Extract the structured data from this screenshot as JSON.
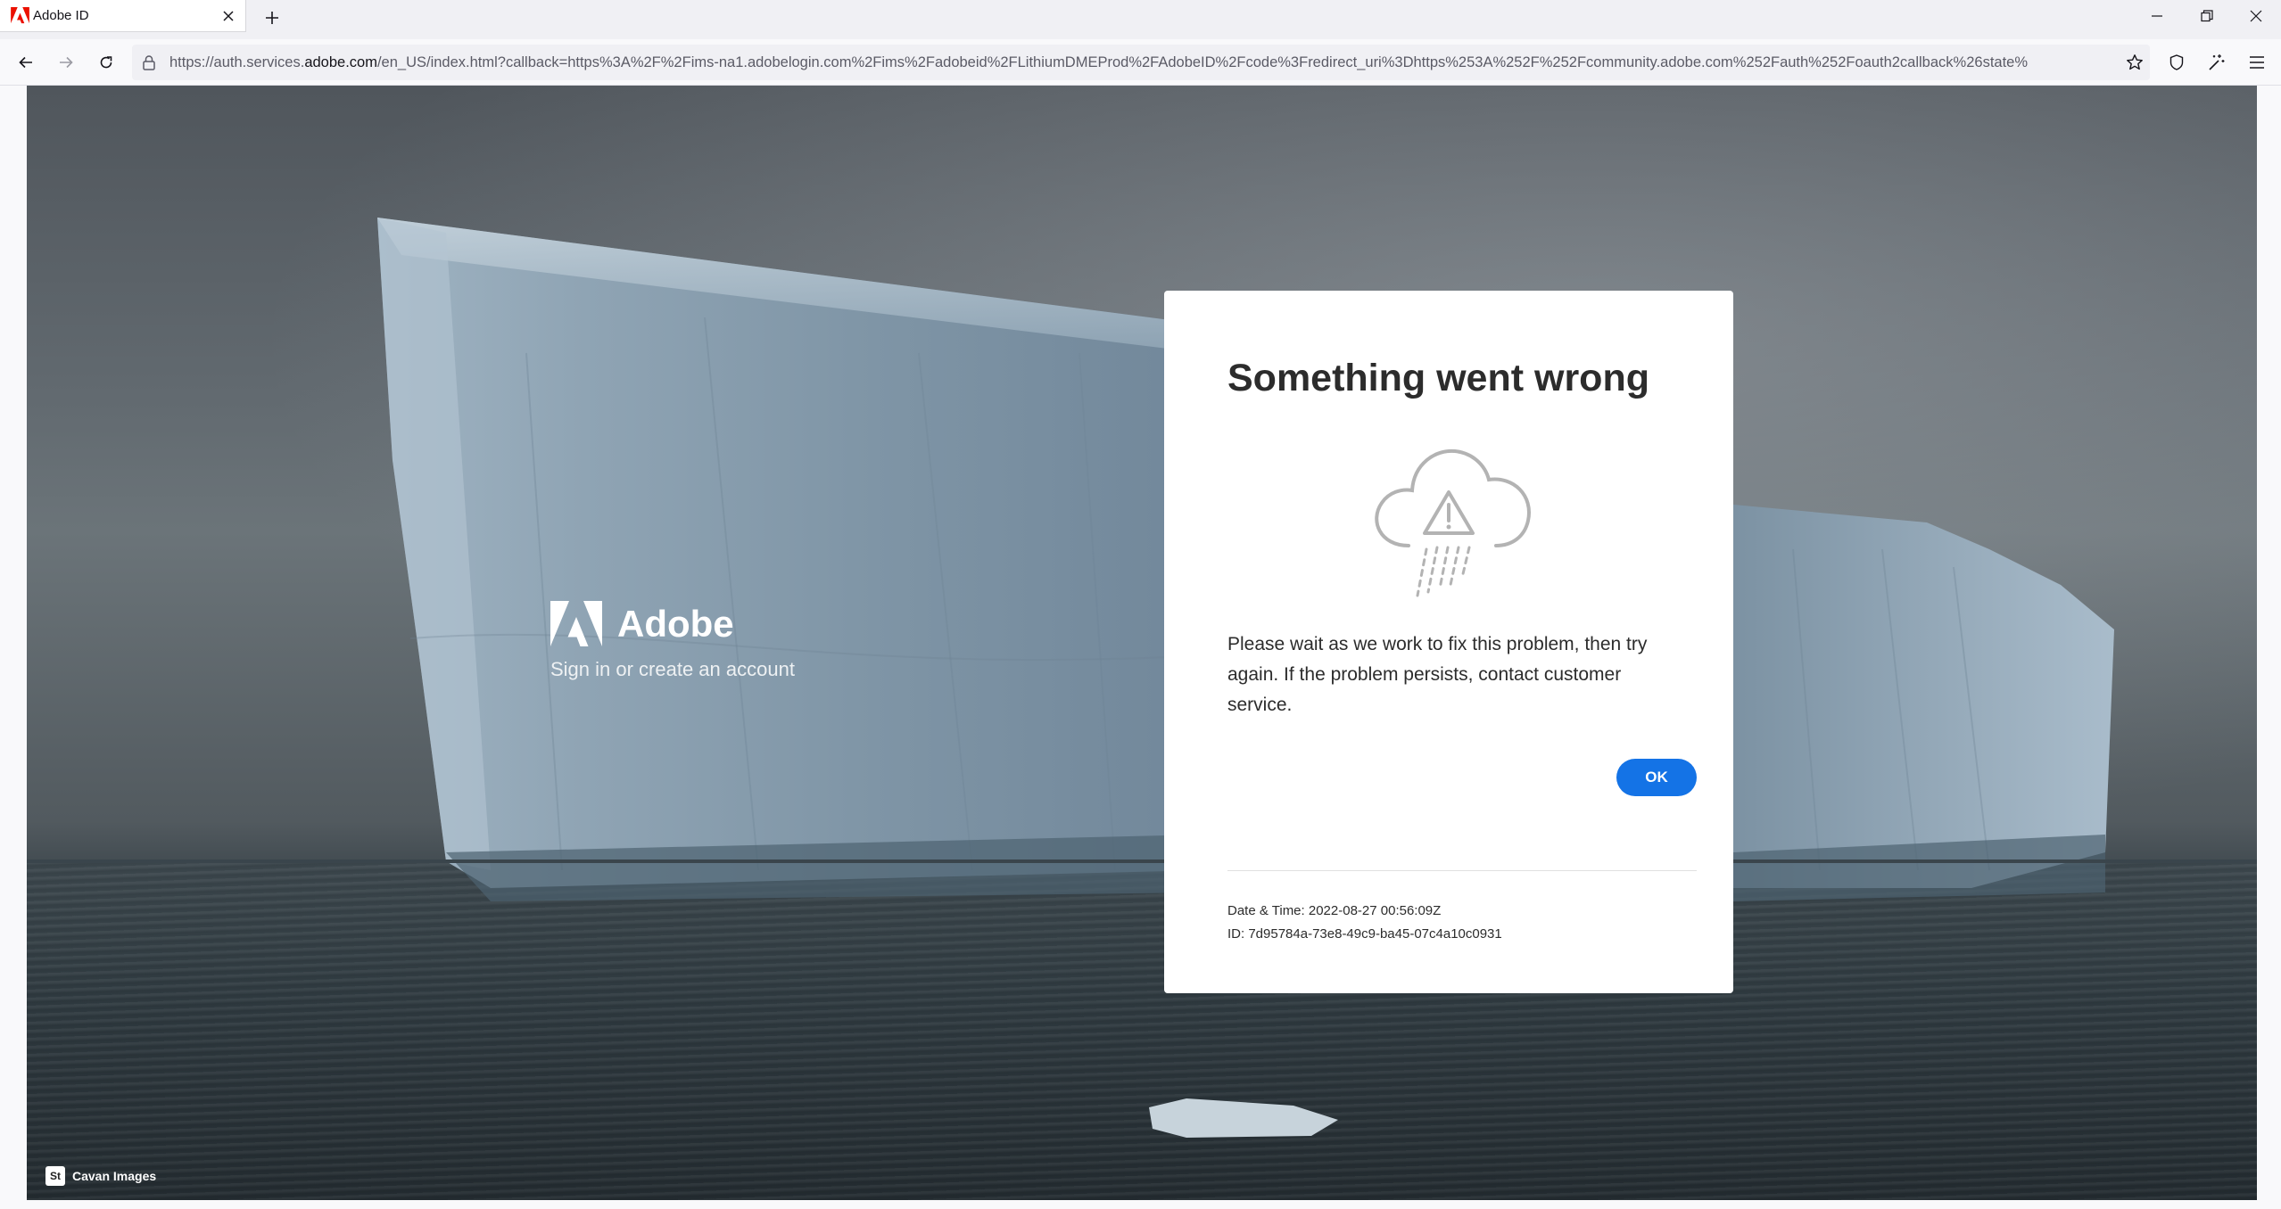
{
  "browser": {
    "tab": {
      "title": "Adobe ID",
      "favicon": "adobe-logo-icon"
    },
    "url": {
      "prefix": "https://auth.services.",
      "domain": "adobe.com",
      "rest": "/en_US/index.html?callback=https%3A%2F%2Fims-na1.adobelogin.com%2Fims%2Fadobeid%2FLithiumDMEProd%2FAdobeID%2Fcode%3Fredirect_uri%3Dhttps%253A%252F%252Fcommunity.adobe.com%252Fauth%252Foauth2callback%26state%"
    },
    "icons": {
      "back": "back-arrow-icon",
      "forward": "forward-arrow-icon",
      "reload": "reload-icon",
      "lock": "lock-icon",
      "bookmark": "star-icon",
      "shield": "shield-icon",
      "extensions": "magic-wand-icon",
      "menu": "hamburger-menu-icon"
    }
  },
  "page": {
    "brand": {
      "name": "Adobe",
      "subtitle": "Sign in or create an account"
    },
    "photo_credit": {
      "badge": "St",
      "text": "Cavan Images"
    }
  },
  "dialog": {
    "title": "Something went wrong",
    "illustration": "cloud-warning-rain-icon",
    "message": "Please wait as we work to fix this problem, then try again. If the problem persists, contact customer service.",
    "ok_label": "OK",
    "datetime": "Date & Time: 2022-08-27 00:56:09Z",
    "id": "ID: 7d95784a-73e8-49c9-ba45-07c4a10c0931"
  },
  "colors": {
    "accent": "#1473e6",
    "adobe_red": "#eb1000"
  }
}
